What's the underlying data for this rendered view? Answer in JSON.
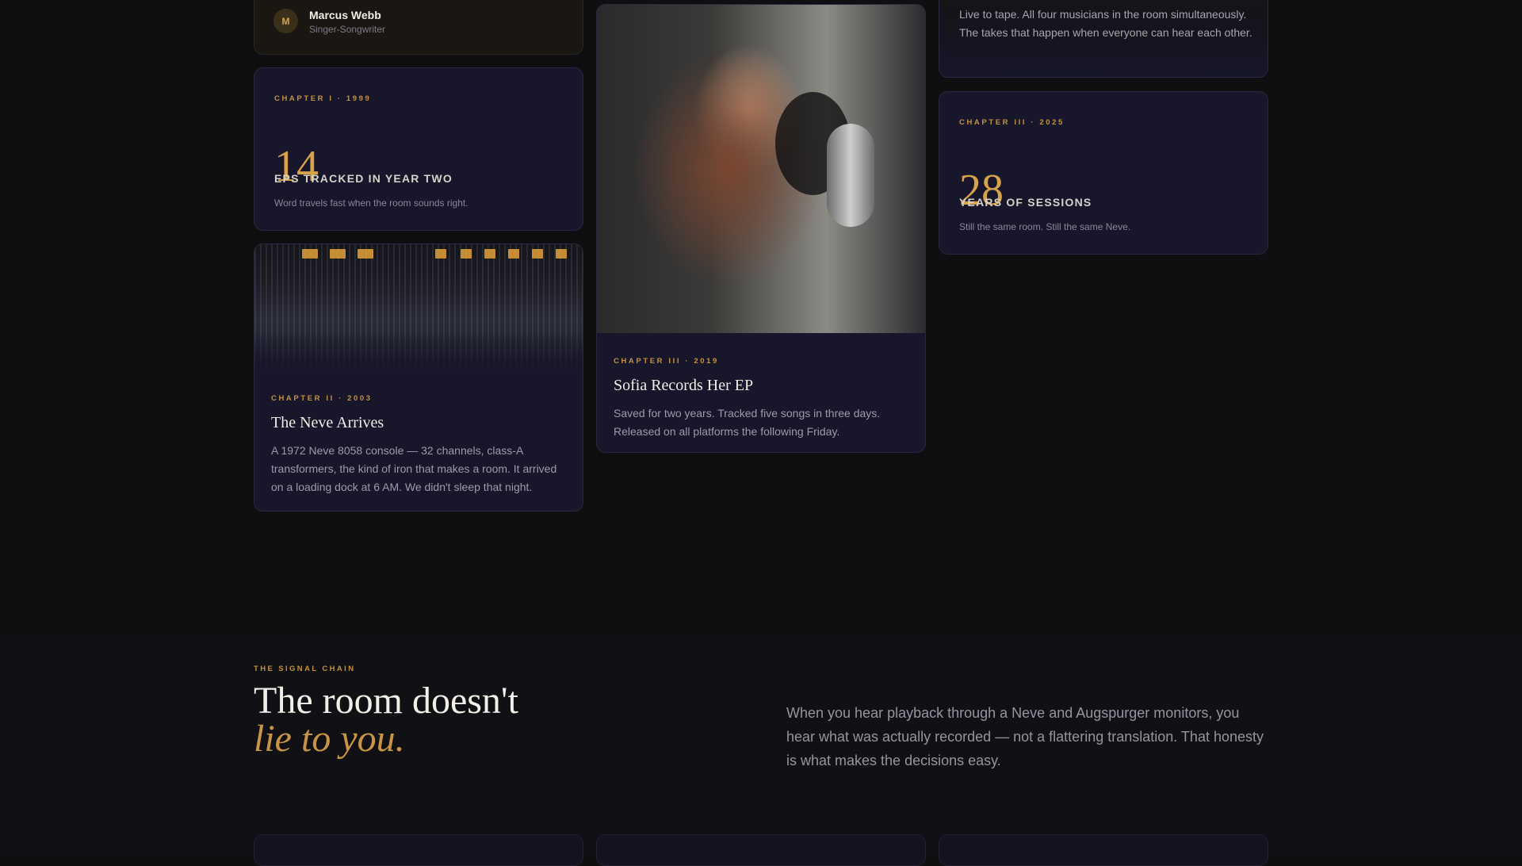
{
  "testimonial": {
    "avatar_initial": "M",
    "name": "Marcus Webb",
    "role": "Singer-Songwriter"
  },
  "stat_card_1": {
    "chapter": "CHAPTER I · 1999",
    "number": "14",
    "label": "EPS TRACKED IN YEAR TWO",
    "desc": "Word travels fast when the room sounds right."
  },
  "story_card_neve": {
    "chapter": "CHAPTER II · 2003",
    "title": "The Neve Arrives",
    "body": "A 1972 Neve 8058 console — 32 channels, class-A transformers, the kind of iron that makes a room. It arrived on a loading dock at 6 AM. We didn't sleep that night."
  },
  "story_card_sofia": {
    "chapter": "CHAPTER III · 2019",
    "title": "Sofia Records Her EP",
    "body": "Saved for two years. Tracked five songs in three days. Released on all platforms the following Friday."
  },
  "story_card_band": {
    "body": "Live to tape. All four musicians in the room simultaneously. The takes that happen when everyone can hear each other."
  },
  "stat_card_2": {
    "chapter": "CHAPTER III · 2025",
    "number": "28",
    "label": "YEARS OF SESSIONS",
    "desc": "Still the same room. Still the same Neve."
  },
  "signal_chain": {
    "eyebrow": "THE SIGNAL CHAIN",
    "headline_line1": "The room doesn't",
    "headline_line2": "lie to you.",
    "lead": "When you hear playback through a Neve and Augspurger monitors, you hear what was actually recorded — not a flattering translation. That honesty is what makes the decisions easy."
  },
  "colors": {
    "accent": "#d6a24a",
    "background": "#0f0f12",
    "card": "#17162a"
  }
}
